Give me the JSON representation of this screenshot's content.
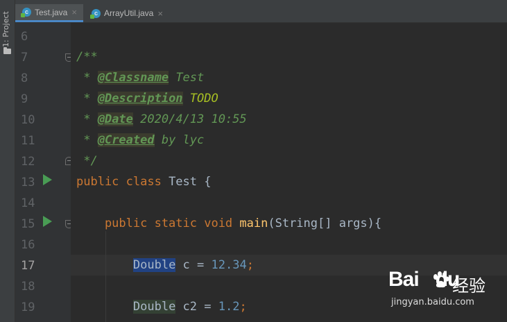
{
  "sidebar": {
    "label": "1: Project",
    "icon": "folder-icon"
  },
  "tabs": [
    {
      "label": "Test.java",
      "active": true,
      "icon": "java-class-icon"
    },
    {
      "label": "ArrayUtil.java",
      "active": false,
      "icon": "java-class-icon"
    }
  ],
  "editor": {
    "current_line": 17,
    "lines": [
      {
        "num": "6"
      },
      {
        "num": "7",
        "t1": "/**"
      },
      {
        "num": "8",
        "t1": " * ",
        "t2": "@Classname",
        "t3": " Test"
      },
      {
        "num": "9",
        "t1": " * ",
        "t2": "@Description",
        "t3": " TODO"
      },
      {
        "num": "10",
        "t1": " * ",
        "t2": "@Date",
        "t3": " 2020/4/13 10:55"
      },
      {
        "num": "11",
        "t1": " * ",
        "t2": "@Created",
        "t3": " by lyc"
      },
      {
        "num": "12",
        "t1": " */"
      },
      {
        "num": "13",
        "t1": "public class ",
        "t2": "Test {"
      },
      {
        "num": "14"
      },
      {
        "num": "15",
        "t1": "    public static void ",
        "t2": "main",
        "t3": "(String[] args){"
      },
      {
        "num": "16"
      },
      {
        "num": "17",
        "t1": "        ",
        "t2": "Double",
        "t3": " c = ",
        "t4": "12.34",
        "t5": ";"
      },
      {
        "num": "18"
      },
      {
        "num": "19",
        "t1": "        ",
        "t2": "Double",
        "t3": " c2 = ",
        "t4": "1.2",
        "t5": ";"
      }
    ]
  },
  "watermark": {
    "logo": "Bai",
    "logo2": "du",
    "cn": "经验",
    "url": "jingyan.baidu.com"
  }
}
